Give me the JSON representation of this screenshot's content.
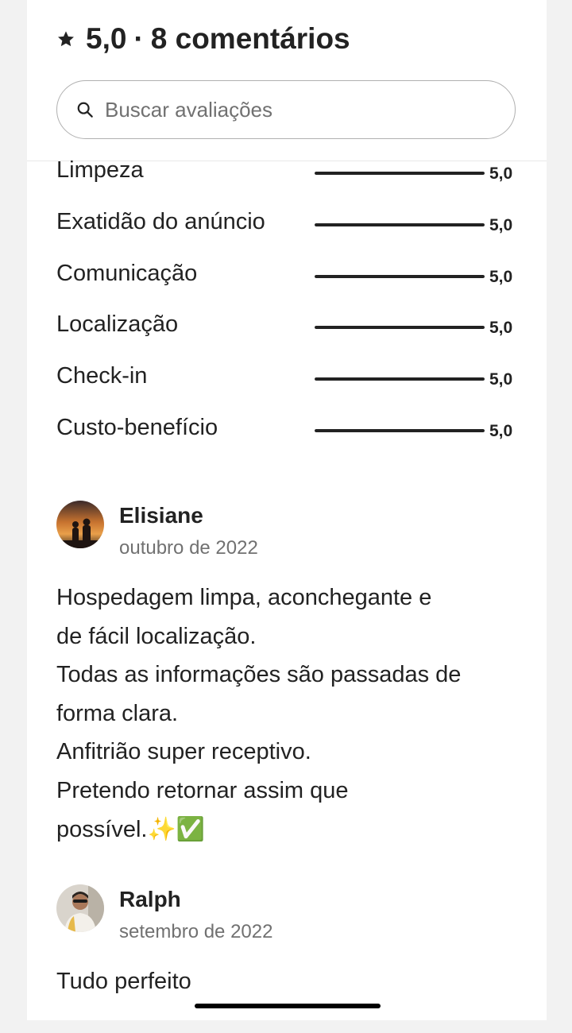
{
  "header": {
    "rating": "5,0",
    "separator": "·",
    "comments": "8 comentários",
    "star_icon": "star-icon"
  },
  "search": {
    "placeholder": "Buscar avaliações",
    "value": "",
    "icon": "search-icon"
  },
  "categories": [
    {
      "label": "Limpeza",
      "score": "5,0",
      "fraction": 1.0
    },
    {
      "label": "Exatidão do anúncio",
      "score": "5,0",
      "fraction": 1.0
    },
    {
      "label": "Comunicação",
      "score": "5,0",
      "fraction": 1.0
    },
    {
      "label": "Localização",
      "score": "5,0",
      "fraction": 1.0
    },
    {
      "label": "Check-in",
      "score": "5,0",
      "fraction": 1.0
    },
    {
      "label": "Custo-benefício",
      "score": "5,0",
      "fraction": 1.0
    }
  ],
  "reviews": [
    {
      "name": "Elisiane",
      "date": "outubro de 2022",
      "text_lines": [
        "Hospedagem limpa, aconchegante e",
        "de fácil localização.",
        "Todas as informações são passadas de",
        "forma clara.",
        "Anfitrião super receptivo.",
        "Pretendo retornar assim que",
        "possível.✨✅"
      ]
    },
    {
      "name": "Ralph",
      "date": "setembro de 2022",
      "text_lines": [
        "Tudo perfeito"
      ]
    }
  ],
  "colors": {
    "text_primary": "#222222",
    "text_secondary": "#717171",
    "bar_fill": "#222222",
    "background": "#f2f2f2"
  }
}
